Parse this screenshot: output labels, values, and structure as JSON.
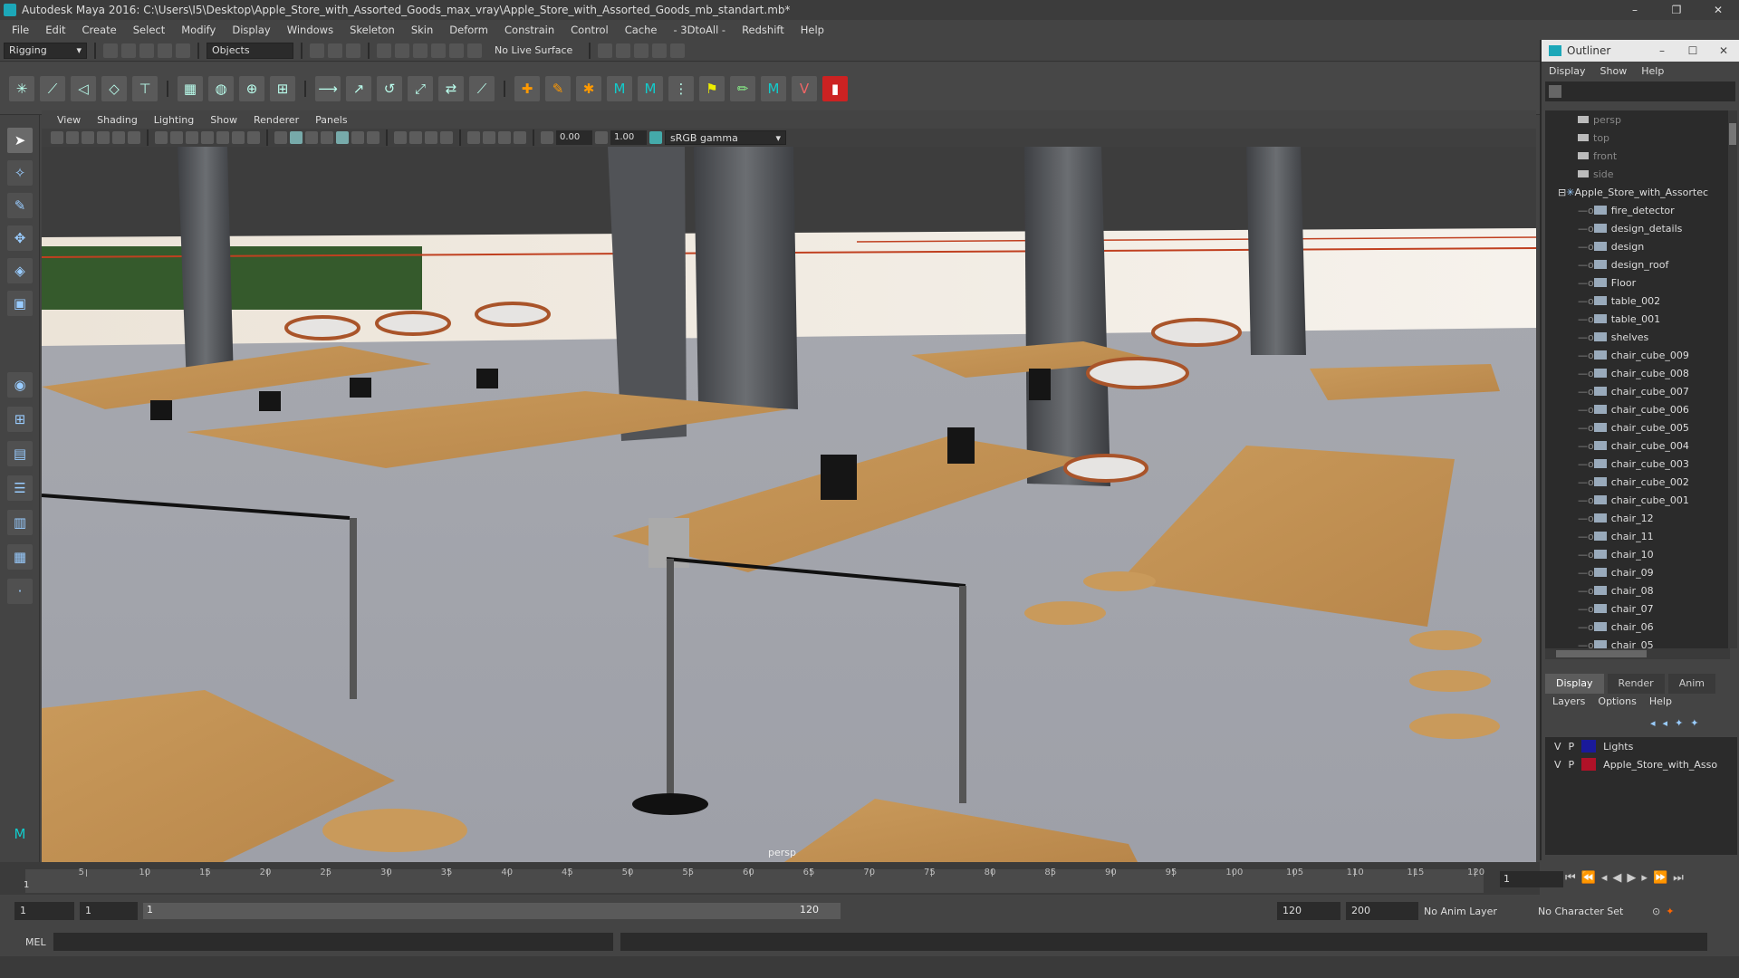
{
  "window": {
    "title": "Autodesk Maya 2016: C:\\Users\\I5\\Desktop\\Apple_Store_with_Assorted_Goods_max_vray\\Apple_Store_with_Assorted_Goods_mb_standart.mb*",
    "minimize": "–",
    "maximize": "❐",
    "close": "✕"
  },
  "menubar": [
    "File",
    "Edit",
    "Create",
    "Select",
    "Modify",
    "Display",
    "Windows",
    "Skeleton",
    "Skin",
    "Deform",
    "Constrain",
    "Control",
    "Cache",
    "- 3DtoAll -",
    "Redshift",
    "Help"
  ],
  "statusline": {
    "menuset": "Rigging",
    "selection_mode": "Objects",
    "live_surface": "No Live Surface"
  },
  "panel": {
    "menus": [
      "View",
      "Shading",
      "Lighting",
      "Show",
      "Renderer",
      "Panels"
    ],
    "exposure": "0.00",
    "gamma": "1.00",
    "color_space": "sRGB gamma",
    "camera_label": "persp"
  },
  "timeline": {
    "ticks": [
      5,
      10,
      15,
      20,
      25,
      30,
      35,
      40,
      45,
      50,
      55,
      60,
      65,
      70,
      75,
      80,
      85,
      90,
      95,
      100,
      105,
      110,
      115,
      120
    ],
    "start_label": "1",
    "current_frame": "1"
  },
  "range": {
    "start": "1",
    "anim_start": "1",
    "slider_start": "1",
    "slider_end": "120",
    "anim_end": "120",
    "end": "200",
    "anim_layer": "No Anim Layer",
    "character_set": "No Character Set"
  },
  "cmdline": {
    "label": "MEL"
  },
  "outliner": {
    "title": "Outliner",
    "menus": [
      "Display",
      "Show",
      "Help"
    ],
    "cameras": [
      "persp",
      "top",
      "front",
      "side"
    ],
    "root": "Apple_Store_with_Assortec",
    "children": [
      "fire_detector",
      "design_details",
      "design",
      "design_roof",
      "Floor",
      "table_002",
      "table_001",
      "shelves",
      "chair_cube_009",
      "chair_cube_008",
      "chair_cube_007",
      "chair_cube_006",
      "chair_cube_005",
      "chair_cube_004",
      "chair_cube_003",
      "chair_cube_002",
      "chair_cube_001",
      "chair_12",
      "chair_11",
      "chair_10",
      "chair_09",
      "chair_08",
      "chair_07",
      "chair_06",
      "chair_05"
    ]
  },
  "layers": {
    "tabs": [
      "Display",
      "Render",
      "Anim"
    ],
    "menus": [
      "Layers",
      "Options",
      "Help"
    ],
    "rows": [
      {
        "v": "V",
        "p": "P",
        "name": "Lights",
        "color": "#1a1a9a"
      },
      {
        "v": "V",
        "p": "P",
        "name": "Apple_Store_with_Asso",
        "color": "#b01228"
      }
    ]
  }
}
